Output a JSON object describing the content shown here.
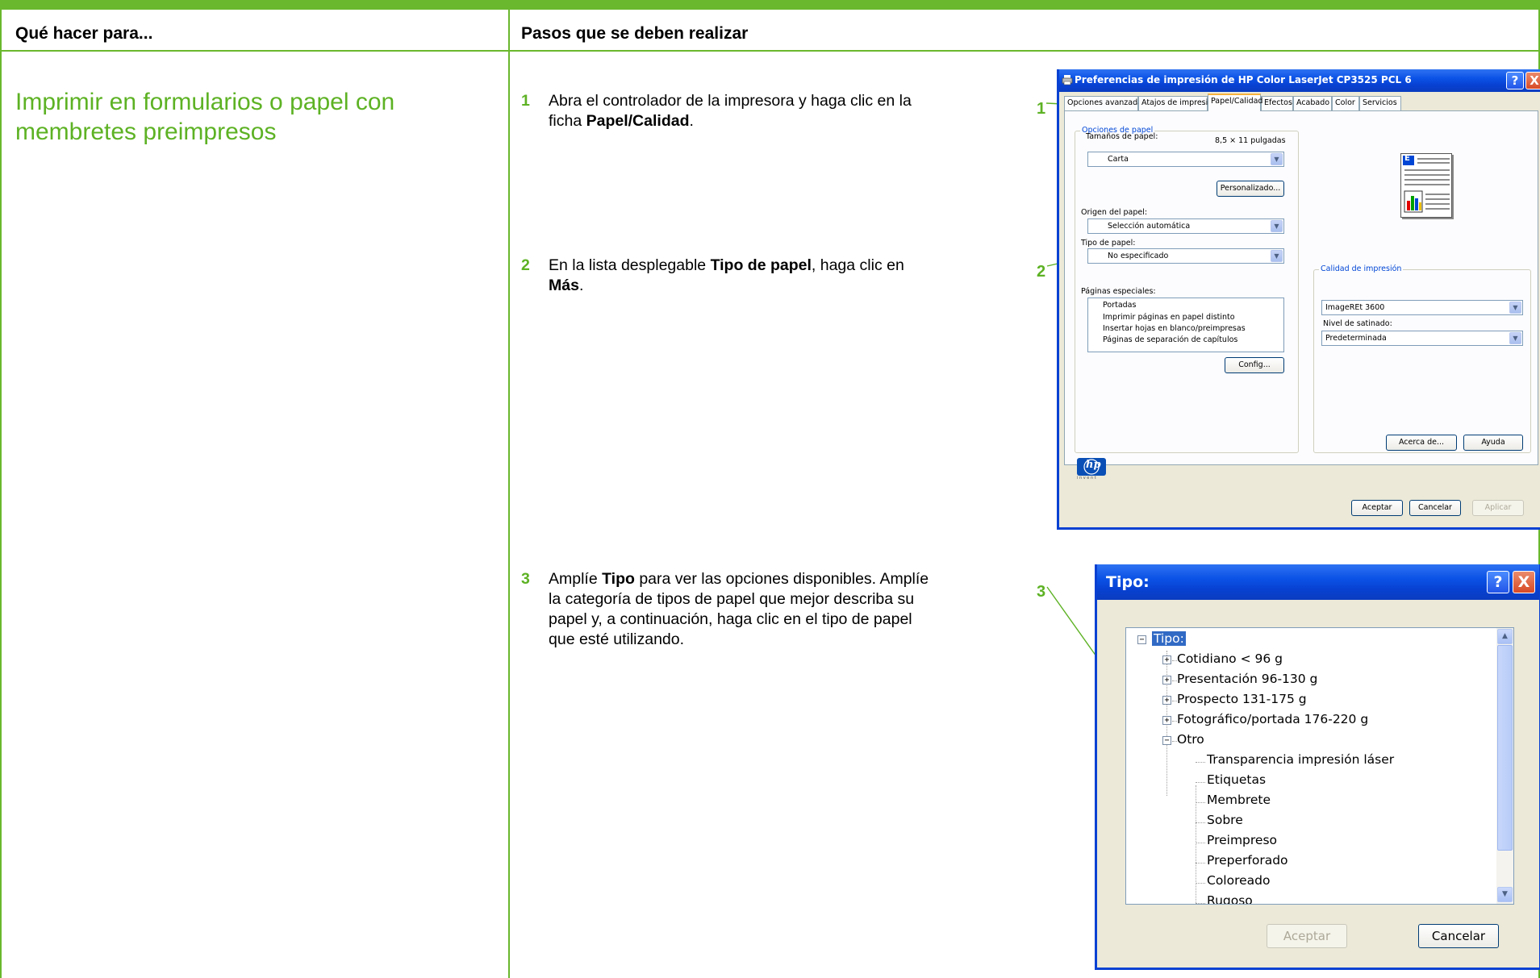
{
  "headers": {
    "col1": "Qué hacer para...",
    "col2": "Pasos que se deben realizar"
  },
  "task": {
    "title_line1": "Imprimir en formularios o papel con",
    "title_line2": "membretes preimpresos"
  },
  "steps": [
    {
      "number": "1",
      "line1": "Abra el controlador de la impresora y haga clic en la",
      "line2_pre": "ficha ",
      "line2_bold": "Papel/Calidad",
      "line2_post": "."
    },
    {
      "number": "2",
      "line1_pre": "En la lista desplegable ",
      "line1_bold": "Tipo de papel",
      "line1_post": ", haga clic en",
      "line2_bold": "Más",
      "line2_post": "."
    },
    {
      "number": "3",
      "line1_pre": "Amplíe ",
      "line1_bold": "Tipo",
      "line1_post": " para ver las opciones disponibles. Amplíe",
      "line2": "la categoría de tipos de papel que mejor describa su",
      "line3": "papel y, a continuación, haga clic en el tipo de papel",
      "line4": "que esté utilizando."
    }
  ],
  "callouts": [
    "1",
    "2",
    "3"
  ],
  "preferences_dialog": {
    "title": "Preferencias de impresión de HP Color LaserJet CP3525 PCL 6",
    "help_button": "?",
    "close_button": "X",
    "tabs": [
      "Opciones avanzadas",
      "Atajos de impresión",
      "Papel/Calidad",
      "Efectos",
      "Acabado",
      "Color",
      "Servicios"
    ],
    "active_tab": "Papel/Calidad",
    "paper_options_group": "Opciones de papel",
    "paper_sizes_label": "Tamaños de papel:",
    "paper_size_dim": "8,5 × 11 pulgadas",
    "paper_size_value": "Carta",
    "custom_button": "Personalizado...",
    "source_label": "Origen del papel:",
    "source_value": "Selección automática",
    "type_label": "Tipo de papel:",
    "type_value": "No especificado",
    "special_pages_label": "Páginas especiales:",
    "special_pages": [
      "Portadas",
      "Imprimir páginas en papel distinto",
      "Insertar hojas en blanco/preimpresas",
      "Páginas de separación de capítulos"
    ],
    "config_button": "Config...",
    "quality_group": "Calidad de impresión",
    "quality_value": "ImageREt 3600",
    "saturation_label": "Nivel de satinado:",
    "saturation_value": "Predeterminada",
    "about_button": "Acerca de...",
    "help_btn": "Ayuda",
    "ok_button": "Aceptar",
    "cancel_button": "Cancelar",
    "apply_button": "Aplicar",
    "logo_text": "hp",
    "logo_sub": "i n v e n t",
    "paper_icon_letter": "E"
  },
  "type_dialog": {
    "title": "Tipo:",
    "help_button": "?",
    "close_button": "X",
    "root": "Tipo:",
    "categories": [
      "Cotidiano < 96 g",
      "Presentación 96-130 g",
      "Prospecto 131-175 g",
      "Fotográfico/portada 176-220 g",
      "Otro"
    ],
    "other_items": [
      "Transparencia impresión láser",
      "Etiquetas",
      "Membrete",
      "Sobre",
      "Preimpreso",
      "Preperforado",
      "Coloreado",
      "Rugoso"
    ],
    "ok_button": "Aceptar",
    "cancel_button": "Cancelar"
  },
  "colors": {
    "accent_green": "#6ab82e",
    "xp_title_blue": "#0841d2",
    "selection_blue": "#316ac5"
  }
}
